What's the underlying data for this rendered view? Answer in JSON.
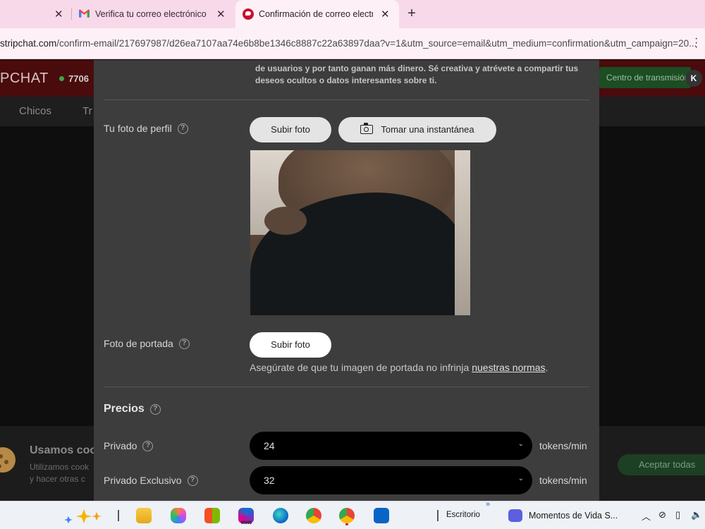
{
  "browser": {
    "tabs": [
      {
        "title": "",
        "active": false
      },
      {
        "title": "Verifica tu correo electrónico - ",
        "active": false
      },
      {
        "title": "Confirmación de correo electró",
        "active": true
      }
    ],
    "new_tab": "+",
    "url_prefix": "",
    "url_host": "stripchat.com",
    "url_path": "/confirm-email/217697987/d26ea7107aa74e6b8be1346c8887c22a63897daa?v=1&utm_source=email&utm_medium=confirmation&utm_campaign=20..."
  },
  "site": {
    "logo": "PCHAT",
    "online_count": "7706",
    "broadcast_button": "Centro de transmisión",
    "avatar_initial": "K",
    "nav": [
      "Chicos",
      "Tr"
    ]
  },
  "cookies": {
    "title": "Usamos coo",
    "text_line1": "Utilizamos cook",
    "text_line2": "y hacer otras c",
    "accept": "Aceptar todas"
  },
  "modal": {
    "top_text": "de usuarios y por tanto ganan más dinero. Sé creativa y atrévete a compartir tus deseos ocultos o datos interesantes sobre ti.",
    "profile_photo": {
      "label": "Tu foto de perfil",
      "upload_button": "Subir foto",
      "snapshot_button": "Tomar una instantánea"
    },
    "cover_photo": {
      "label": "Foto de portada",
      "upload_button": "Subir foto",
      "note_prefix": "Asegúrate de que tu imagen de portada no infrinja ",
      "note_link": "nuestras normas",
      "note_suffix": "."
    },
    "prices": {
      "title": "Precios",
      "private": {
        "label": "Privado",
        "value": "24",
        "unit": "tokens/min"
      },
      "exclusive": {
        "label": "Privado Exclusivo",
        "value": "32",
        "unit": "tokens/min"
      }
    }
  },
  "taskbar": {
    "explorer_label": "Escritorio",
    "window_title": "Momentos de Vida S...",
    "chevron": "»",
    "m365": "M365"
  }
}
